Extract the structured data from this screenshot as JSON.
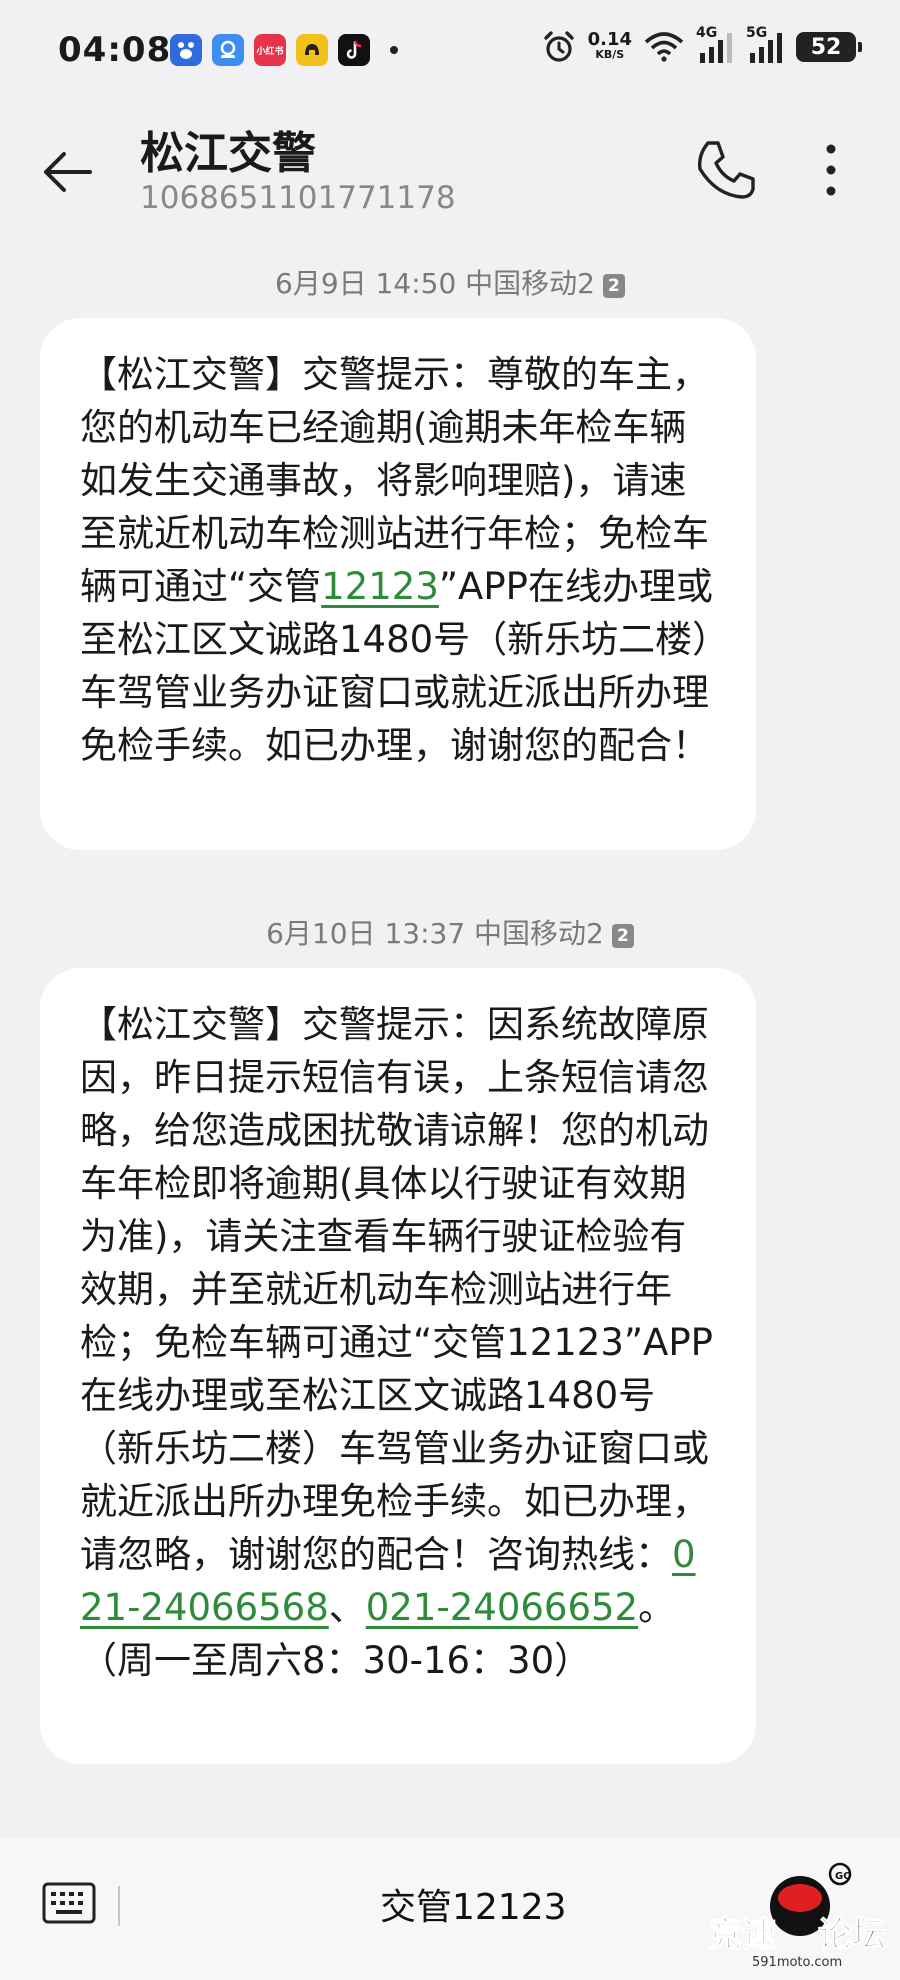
{
  "status_bar": {
    "time": "04:08",
    "app_icons": [
      {
        "name": "baidu-app-icon",
        "color": "#2f6bdc"
      },
      {
        "name": "assistant-app-icon",
        "color": "#3d8ef0"
      },
      {
        "name": "xiaohongshu-app-icon",
        "color": "#e8344a",
        "text": "小红书"
      },
      {
        "name": "game-app-icon",
        "color": "#f3c21a"
      },
      {
        "name": "tiktok-app-icon",
        "color": "#111111"
      }
    ],
    "net_speed_value": "0.14",
    "net_speed_unit": "KB/S",
    "signal1_label": "4G",
    "signal2_label": "5G",
    "battery": "52"
  },
  "header": {
    "title": "松江交警",
    "number": "1068651101771178"
  },
  "messages": [
    {
      "timestamp": "6月9日 14:50 中国移动2",
      "sim": "2",
      "body_part1": "【松江交警】交警提示：尊敬的车主，您的机动车已经逾期(逾期未年检车辆如发生交通事故，将影响理赔)，请速至就近机动车检测站进行年检；免检车辆可通过“交管",
      "link": "12123",
      "body_part2": "”APP在线办理或至松江区文诚路1480号（新乐坊二楼）车驾管业务办证窗口或就近派出所办理免检手续。如已办理，谢谢您的配合！"
    },
    {
      "timestamp": "6月10日 13:37 中国移动2",
      "sim": "2",
      "body_part1": "【松江交警】交警提示：因系统故障原因，昨日提示短信有误，上条短信请忽略，给您造成困扰敬请谅解！您的机动车年检即将逾期(具体以行驶证有效期为准)，请关注查看车辆行驶证检验有效期，并至就近机动车检测站进行年检；免检车辆可通过“交管12123”APP在线办理或至松江区文诚路1480号（新乐坊二楼）车驾管业务办证窗口或就近派出所办理免检手续。如已办理，请忽略，谢谢您的配合！咨询热线：",
      "phone1": "021-24066568",
      "separator": "、",
      "phone2": "021-24066652",
      "body_part2": "。（周一至周六8：30-16：30）"
    }
  ],
  "input_bar": {
    "quick_reply": "交管12123",
    "watermark_text": "竞速论坛",
    "watermark_url": "591moto.com"
  },
  "colors": {
    "link": "#2e8b3a",
    "background": "#f1f1f3",
    "bubble": "#ffffff"
  }
}
